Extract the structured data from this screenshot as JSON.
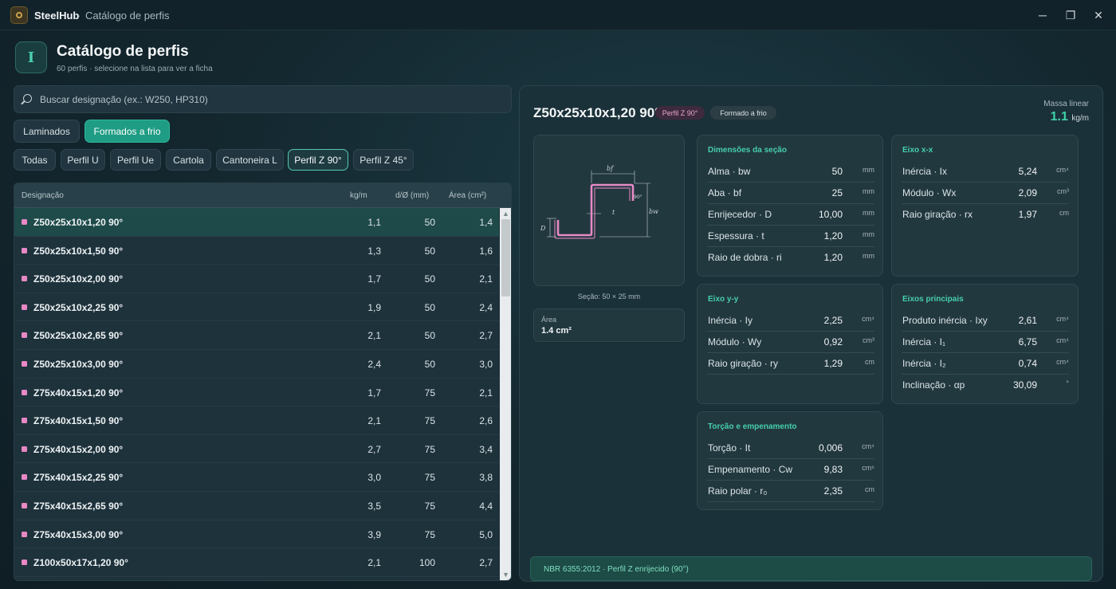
{
  "titlebar": {
    "app_name": "SteelHub",
    "separator": "·",
    "subtitle": "Catálogo de perfis",
    "minimize": "─",
    "restore": "❐",
    "close": "✕"
  },
  "header": {
    "icon_glyph": "I",
    "title": "Catálogo de perfis",
    "subtitle": "60 perfis · selecione na lista para ver a ficha"
  },
  "search": {
    "placeholder": "Buscar designação (ex.: W250, HP310)",
    "value": ""
  },
  "main_tabs": [
    {
      "label": "Laminados",
      "active": false
    },
    {
      "label": "Formados a frio",
      "active": true
    }
  ],
  "filters": [
    {
      "label": "Todas",
      "active": false
    },
    {
      "label": "Perfil U",
      "active": false
    },
    {
      "label": "Perfil Ue",
      "active": false
    },
    {
      "label": "Cartola",
      "active": false
    },
    {
      "label": "Cantoneira L",
      "active": false
    },
    {
      "label": "Perfil Z 90°",
      "active": true
    },
    {
      "label": "Perfil Z 45°",
      "active": false
    }
  ],
  "table": {
    "headers": {
      "name": "Designação",
      "kgm": "kg/m",
      "d": "d/Ø (mm)",
      "area": "Área (cm²)"
    },
    "rows": [
      {
        "name": "Z50x25x10x1,20 90°",
        "kgm": "1,1",
        "d": "50",
        "area": "1,4"
      },
      {
        "name": "Z50x25x10x1,50 90°",
        "kgm": "1,3",
        "d": "50",
        "area": "1,6"
      },
      {
        "name": "Z50x25x10x2,00 90°",
        "kgm": "1,7",
        "d": "50",
        "area": "2,1"
      },
      {
        "name": "Z50x25x10x2,25 90°",
        "kgm": "1,9",
        "d": "50",
        "area": "2,4"
      },
      {
        "name": "Z50x25x10x2,65 90°",
        "kgm": "2,1",
        "d": "50",
        "area": "2,7"
      },
      {
        "name": "Z50x25x10x3,00 90°",
        "kgm": "2,4",
        "d": "50",
        "area": "3,0"
      },
      {
        "name": "Z75x40x15x1,20 90°",
        "kgm": "1,7",
        "d": "75",
        "area": "2,1"
      },
      {
        "name": "Z75x40x15x1,50 90°",
        "kgm": "2,1",
        "d": "75",
        "area": "2,6"
      },
      {
        "name": "Z75x40x15x2,00 90°",
        "kgm": "2,7",
        "d": "75",
        "area": "3,4"
      },
      {
        "name": "Z75x40x15x2,25 90°",
        "kgm": "3,0",
        "d": "75",
        "area": "3,8"
      },
      {
        "name": "Z75x40x15x2,65 90°",
        "kgm": "3,5",
        "d": "75",
        "area": "4,4"
      },
      {
        "name": "Z75x40x15x3,00 90°",
        "kgm": "3,9",
        "d": "75",
        "area": "5,0"
      },
      {
        "name": "Z100x50x17x1,20 90°",
        "kgm": "2,1",
        "d": "100",
        "area": "2,7"
      }
    ],
    "scroll_up": "▲",
    "scroll_down": "▼"
  },
  "detail": {
    "title": "Z50x25x10x1,20 90°",
    "badge_type": "Perfil Z 90°",
    "badge_process": "Formado a frio",
    "mass_label": "Massa linear",
    "mass_value": "1.1",
    "mass_unit": "kg/m",
    "section_caption": "Seção: 50 × 25 mm",
    "drawing_labels": {
      "bf": "bf",
      "bw": "bw",
      "t": "t",
      "D": "D",
      "angle": "90°"
    },
    "area_label": "Área",
    "area_value": "1.4 cm²",
    "cards": {
      "dim": {
        "title": "Dimensões da seção",
        "props": [
          {
            "label": "Alma · bw",
            "value": "50",
            "unit": "mm"
          },
          {
            "label": "Aba · bf",
            "value": "25",
            "unit": "mm"
          },
          {
            "label": "Enrijecedor · D",
            "value": "10,00",
            "unit": "mm"
          },
          {
            "label": "Espessura · t",
            "value": "1,20",
            "unit": "mm"
          },
          {
            "label": "Raio de dobra · ri",
            "value": "1,20",
            "unit": "mm"
          }
        ]
      },
      "xx": {
        "title": "Eixo x-x",
        "props": [
          {
            "label": "Inércia · Ix",
            "value": "5,24",
            "unit": "cm⁴"
          },
          {
            "label": "Módulo · Wx",
            "value": "2,09",
            "unit": "cm³"
          },
          {
            "label": "Raio giração · rx",
            "value": "1,97",
            "unit": "cm"
          }
        ]
      },
      "yy": {
        "title": "Eixo y-y",
        "props": [
          {
            "label": "Inércia · Iy",
            "value": "2,25",
            "unit": "cm⁴"
          },
          {
            "label": "Módulo · Wy",
            "value": "0,92",
            "unit": "cm³"
          },
          {
            "label": "Raio giração · ry",
            "value": "1,29",
            "unit": "cm"
          }
        ]
      },
      "principal": {
        "title": "Eixos principais",
        "props": [
          {
            "label": "Produto inércia · Ixy",
            "value": "2,61",
            "unit": "cm⁴"
          },
          {
            "label": "Inércia · I₁",
            "value": "6,75",
            "unit": "cm⁴"
          },
          {
            "label": "Inércia · I₂",
            "value": "0,74",
            "unit": "cm⁴"
          },
          {
            "label": "Inclinação · αp",
            "value": "30,09",
            "unit": "°"
          }
        ]
      },
      "torsion": {
        "title": "Torção e empenamento",
        "props": [
          {
            "label": "Torção · It",
            "value": "0,006",
            "unit": "cm⁴"
          },
          {
            "label": "Empenamento · Cw",
            "value": "9,83",
            "unit": "cm⁶"
          },
          {
            "label": "Raio polar · r₀",
            "value": "2,35",
            "unit": "cm"
          }
        ]
      }
    },
    "norm": "NBR 6355:2012 · Perfil Z enrijecido (90°)"
  },
  "colors": {
    "accent": "#46cfab",
    "profile_dot": "#e888c4",
    "profile_stroke": "#e68ac6",
    "selected_tab": "#1f9c84"
  }
}
